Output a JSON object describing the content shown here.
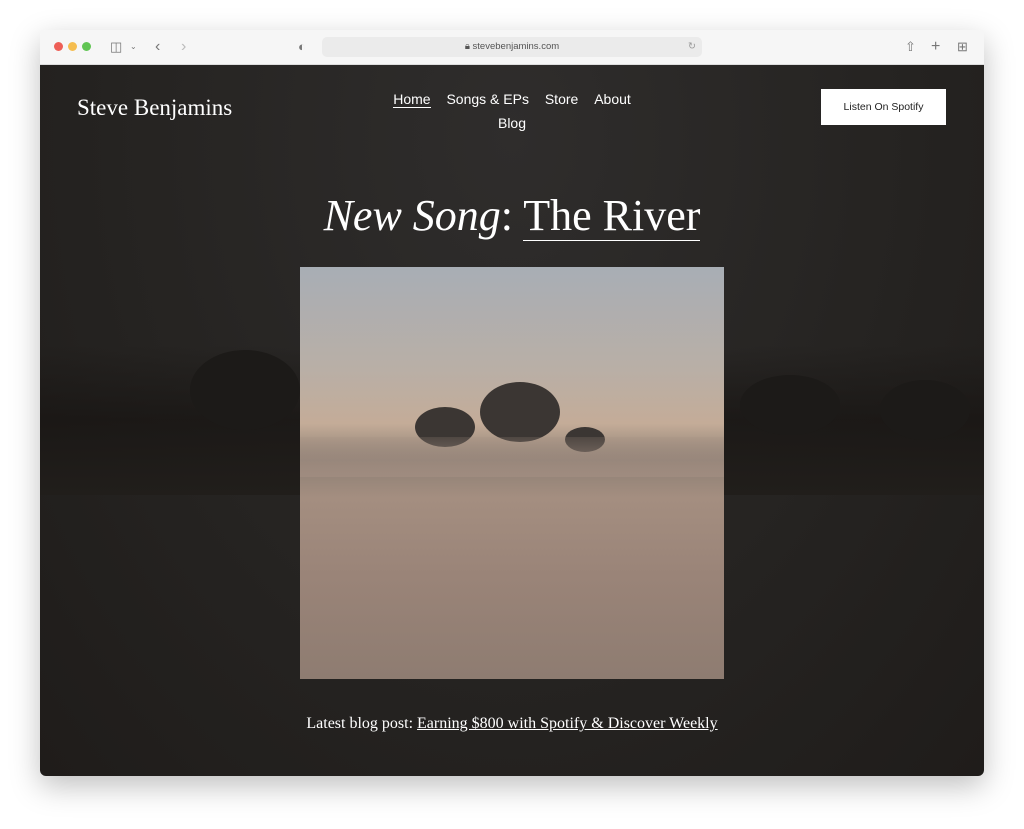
{
  "browser": {
    "url": "stevebenjamins.com",
    "traffic_lights": [
      "#ee5f57",
      "#f5bd4f",
      "#61c554"
    ]
  },
  "site": {
    "logo": "Steve Benjamins",
    "nav": [
      {
        "label": "Home",
        "active": true
      },
      {
        "label": "Songs & EPs"
      },
      {
        "label": "Store"
      },
      {
        "label": "About"
      },
      {
        "label": "Blog"
      }
    ],
    "cta": "Listen On Spotify"
  },
  "hero": {
    "prefix": "New Song",
    "colon": ":",
    "title": "The River"
  },
  "blog": {
    "label": "Latest blog post:",
    "link": "Earning $800 with Spotify & Discover Weekly"
  }
}
